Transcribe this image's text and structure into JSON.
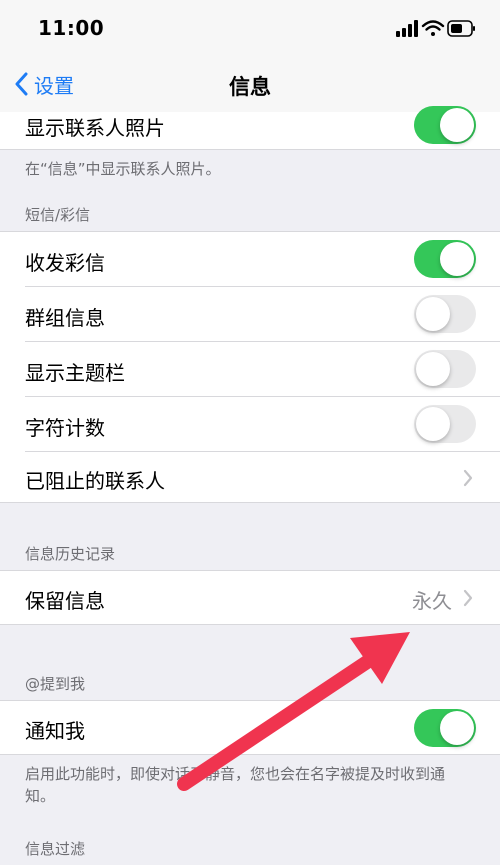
{
  "status": {
    "time": "11:00"
  },
  "nav": {
    "back_label": "设置",
    "title": "信息"
  },
  "show_photos": {
    "label": "显示联系人照片",
    "on": true,
    "footer": "在“信息”中显示联系人照片。"
  },
  "sms_section": {
    "header": "短信/彩信",
    "mms": {
      "label": "收发彩信",
      "on": true
    },
    "group": {
      "label": "群组信息",
      "on": false
    },
    "subject": {
      "label": "显示主题栏",
      "on": false
    },
    "count": {
      "label": "字符计数",
      "on": false
    },
    "blocked": {
      "label": "已阻止的联系人"
    }
  },
  "history_section": {
    "header": "信息历史记录",
    "keep": {
      "label": "保留信息",
      "value": "永久"
    }
  },
  "mention_section": {
    "header": "@提到我",
    "notify": {
      "label": "通知我",
      "on": true
    },
    "footer": "启用此功能时，即使对话已静音，您也会在名字被提及时收到通知。"
  },
  "filter_section": {
    "header": "信息过滤"
  },
  "colors": {
    "toggle_on": "#34c759",
    "accent": "#1e7cf5",
    "annotation_arrow": "#f0344f"
  }
}
